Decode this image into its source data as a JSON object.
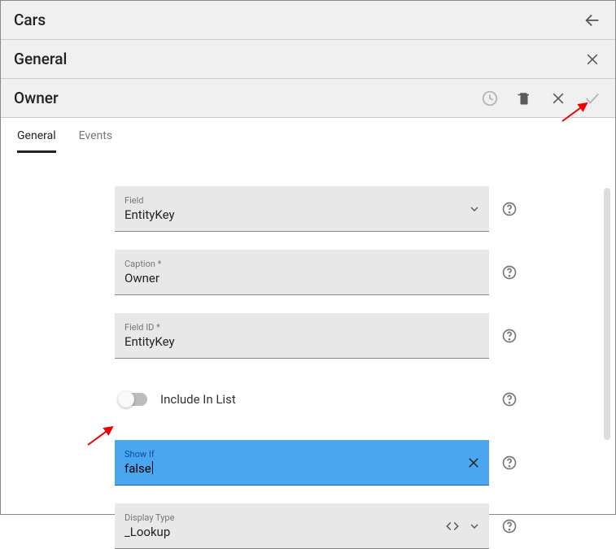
{
  "headers": {
    "level1": "Cars",
    "level2": "General",
    "level3": "Owner"
  },
  "tabs": [
    {
      "label": "General",
      "active": true
    },
    {
      "label": "Events",
      "active": false
    }
  ],
  "form": {
    "field": {
      "label": "Field",
      "value": "EntityKey"
    },
    "caption": {
      "label": "Caption *",
      "value": "Owner"
    },
    "fieldId": {
      "label": "Field ID *",
      "value": "EntityKey"
    },
    "includeInList": {
      "label": "Include In List",
      "value": false
    },
    "showIf": {
      "label": "Show If",
      "value": "false"
    },
    "displayType": {
      "label": "Display Type",
      "value": "_Lookup"
    }
  }
}
